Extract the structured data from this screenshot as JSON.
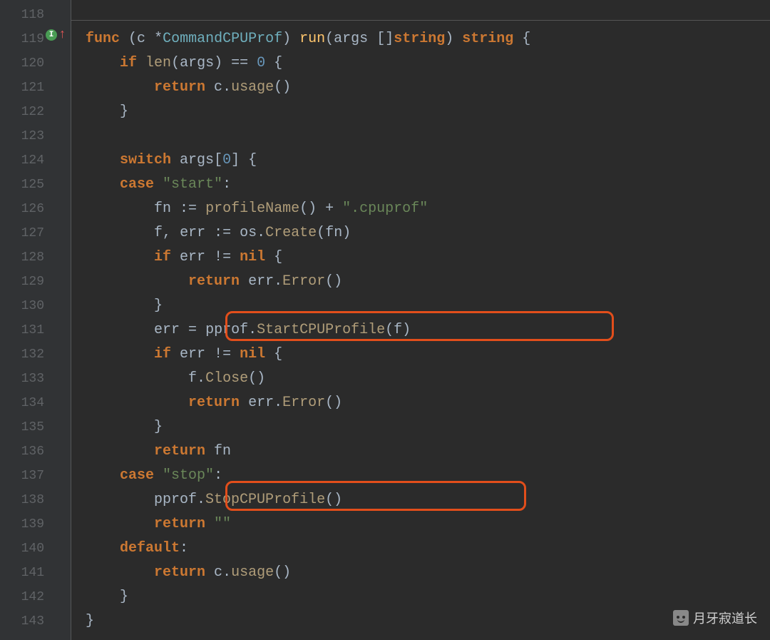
{
  "gutter": {
    "lines": [
      "118",
      "119",
      "120",
      "121",
      "122",
      "123",
      "124",
      "125",
      "126",
      "127",
      "128",
      "129",
      "130",
      "131",
      "132",
      "133",
      "134",
      "135",
      "136",
      "137",
      "138",
      "139",
      "140",
      "141",
      "142",
      "143"
    ],
    "icon_letter": "I",
    "arrow": "↑"
  },
  "code": {
    "l119": {
      "func": "func",
      "c": "c",
      "star": "*",
      "type": "CommandCPUProf",
      "run": "run",
      "args": "args",
      "slice": "[]",
      "string": "string",
      "brace": "{"
    },
    "l120": {
      "if": "if",
      "len": "len",
      "args": "args",
      "eq": "==",
      "zero": "0",
      "brace": "{"
    },
    "l121": {
      "return": "return",
      "c": "c",
      "usage": "usage",
      "parens": "()"
    },
    "l122": {
      "brace": "}"
    },
    "l124": {
      "switch": "switch",
      "args": "args",
      "idx": "[",
      "zero": "0",
      "idx2": "]",
      "brace": "{"
    },
    "l125": {
      "case": "case",
      "str": "\"start\"",
      "colon": ":"
    },
    "l126": {
      "fn": "fn",
      "assign": ":=",
      "profileName": "profileName",
      "parens": "()",
      "plus": "+",
      "str": "\".cpuprof\""
    },
    "l127": {
      "f": "f",
      "comma": ",",
      "err": "err",
      "assign": ":=",
      "os": "os",
      "Create": "Create",
      "fn": "fn"
    },
    "l128": {
      "if": "if",
      "err": "err",
      "ne": "!=",
      "nil": "nil",
      "brace": "{"
    },
    "l129": {
      "return": "return",
      "err": "err",
      "Error": "Error",
      "parens": "()"
    },
    "l130": {
      "brace": "}"
    },
    "l131": {
      "err": "err",
      "eq": "=",
      "pprof": "pprof",
      "Start": "StartCPUProfile",
      "f": "f"
    },
    "l132": {
      "if": "if",
      "err": "err",
      "ne": "!=",
      "nil": "nil",
      "brace": "{"
    },
    "l133": {
      "f": "f",
      "Close": "Close",
      "parens": "()"
    },
    "l134": {
      "return": "return",
      "err": "err",
      "Error": "Error",
      "parens": "()"
    },
    "l135": {
      "brace": "}"
    },
    "l136": {
      "return": "return",
      "fn": "fn"
    },
    "l137": {
      "case": "case",
      "str": "\"stop\"",
      "colon": ":"
    },
    "l138": {
      "pprof": "pprof",
      "Stop": "StopCPUProfile",
      "parens": "()"
    },
    "l139": {
      "return": "return",
      "str": "\"\""
    },
    "l140": {
      "default": "default",
      "colon": ":"
    },
    "l141": {
      "return": "return",
      "c": "c",
      "usage": "usage",
      "parens": "()"
    },
    "l142": {
      "brace": "}"
    },
    "l143": {
      "brace": "}"
    }
  },
  "watermark": {
    "text": "月牙寂道长"
  }
}
